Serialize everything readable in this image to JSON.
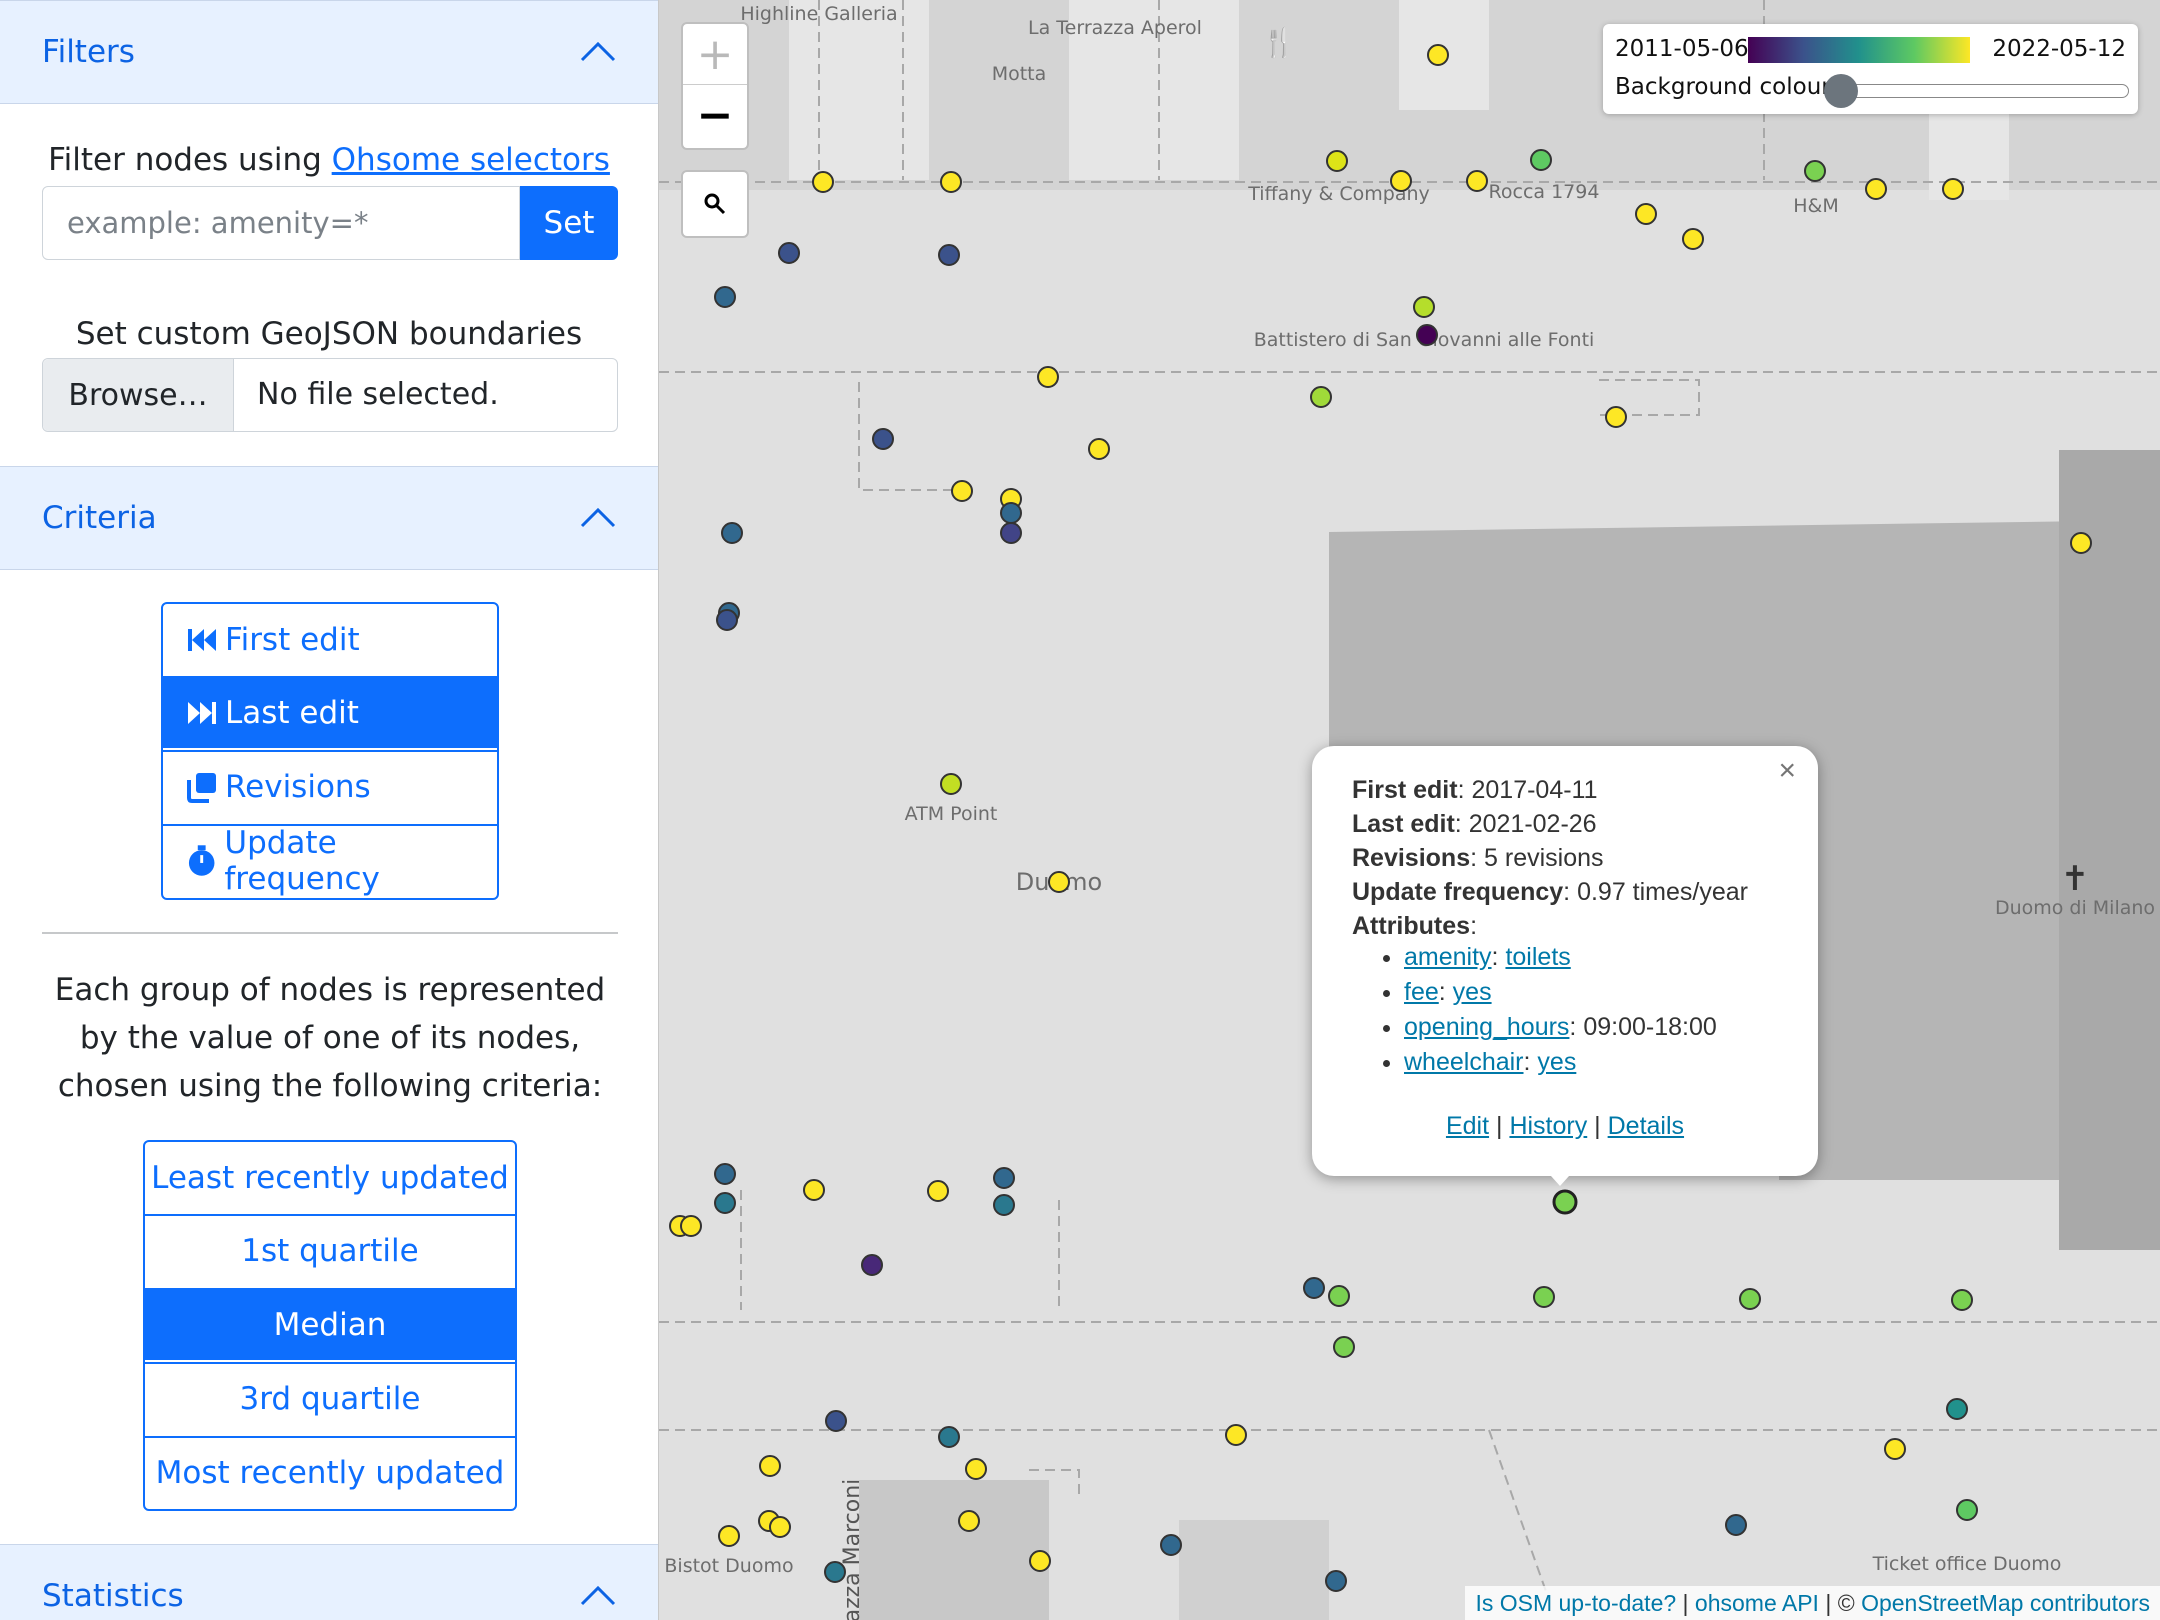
{
  "sidebar": {
    "filters": {
      "title": "Filters",
      "filter_text": "Filter nodes using ",
      "filter_link": "Ohsome selectors",
      "input_placeholder": "example: amenity=*",
      "set_label": "Set",
      "geojson_label": "Set custom GeoJSON boundaries",
      "browse_label": "Browse…",
      "no_file": "No file selected."
    },
    "criteria": {
      "title": "Criteria",
      "modes": [
        {
          "label": "First edit",
          "icon": "backward-step-icon",
          "active": false
        },
        {
          "label": "Last edit",
          "icon": "forward-step-icon",
          "active": true
        },
        {
          "label": "Revisions",
          "icon": "copy-icon",
          "active": false
        },
        {
          "label": "Update frequency",
          "icon": "stopwatch-icon",
          "active": false
        }
      ],
      "description": "Each group of nodes is represented by the value of one of its nodes, chosen using the following criteria:",
      "options": [
        {
          "label": "Least recently updated",
          "active": false
        },
        {
          "label": "1st quartile",
          "active": false
        },
        {
          "label": "Median",
          "active": true
        },
        {
          "label": "3rd quartile",
          "active": false
        },
        {
          "label": "Most recently updated",
          "active": false
        }
      ]
    },
    "statistics": {
      "title": "Statistics"
    }
  },
  "map": {
    "zoom_in": "+",
    "zoom_out": "−",
    "legend": {
      "min": "2011-05-06",
      "max": "2022-05-12",
      "background_label": "Background colour",
      "background_level": 0
    },
    "labels": [
      "Highline Galleria",
      "La Terrazza Aperol",
      "Motta",
      "Tiffany & Company",
      "Rocca 1794",
      "H&M",
      "Battistero di San Giovanni alle Fonti",
      "ATM Point",
      "Duomo",
      "Duomo di Milano",
      "Bistot Duomo",
      "Ticket office Duomo",
      "Piazza Marconi"
    ],
    "popup": {
      "first_edit_label": "First edit",
      "first_edit": "2017-04-11",
      "last_edit_label": "Last edit",
      "last_edit": "2021-02-26",
      "revisions_label": "Revisions",
      "revisions": "5 revisions",
      "update_freq_label": "Update frequency",
      "update_freq": "0.97 times/year",
      "attributes_label": "Attributes",
      "attributes": [
        {
          "key": "amenity",
          "value": "toilets",
          "value_link": true
        },
        {
          "key": "fee",
          "value": "yes",
          "value_link": true
        },
        {
          "key": "opening_hours",
          "value": "09:00-18:00",
          "value_link": false
        },
        {
          "key": "wheelchair",
          "value": "yes",
          "value_link": true
        }
      ],
      "edit_link": "Edit",
      "history_link": "History",
      "details_link": "Details",
      "close": "×"
    },
    "attribution": {
      "link1": "Is OSM up-to-date?",
      "link2": "ohsome API",
      "copyright": "©",
      "link3": "OpenStreetMap contributors"
    }
  }
}
